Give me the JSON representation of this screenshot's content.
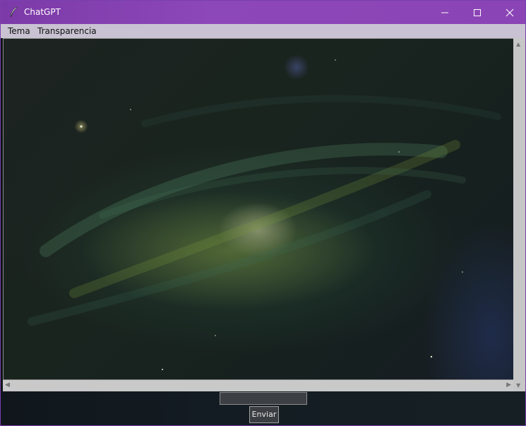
{
  "window": {
    "title": "ChatGPT",
    "title_icon": "feather-icon",
    "controls": {
      "minimize_icon": "minimize-icon",
      "maximize_icon": "maximize-icon",
      "close_icon": "close-icon"
    },
    "titlebar_color": "#8b44b5"
  },
  "menubar": {
    "items": [
      {
        "label": "Tema"
      },
      {
        "label": "Transparencia"
      }
    ]
  },
  "chat": {
    "background": "galaxy-wallpaper"
  },
  "input": {
    "value": "",
    "placeholder": ""
  },
  "send_button": {
    "label": "Enviar"
  }
}
